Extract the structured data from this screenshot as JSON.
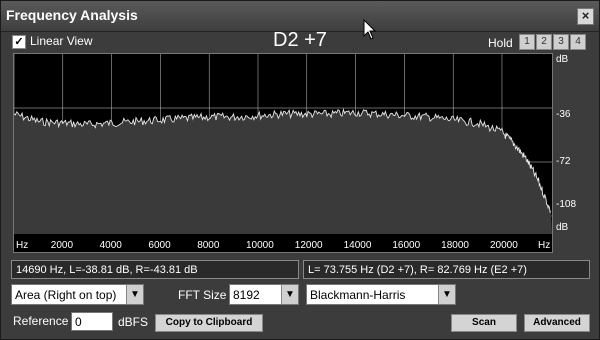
{
  "window": {
    "title": "Frequency Analysis",
    "close_symbol": "×"
  },
  "header": {
    "linear_view_label": "Linear View",
    "linear_view_checked": true,
    "note_label": "D2 +7",
    "hold_label": "Hold",
    "hold_buttons": [
      "1",
      "2",
      "3",
      "4"
    ]
  },
  "plot": {
    "y_axis_labels": [
      "dB",
      "-36",
      "-72",
      "-108",
      "dB"
    ],
    "x_axis_labels": [
      "Hz",
      "2000",
      "4000",
      "6000",
      "8000",
      "10000",
      "12000",
      "14000",
      "16000",
      "18000",
      "20000",
      "Hz"
    ]
  },
  "chart_data": {
    "type": "area",
    "xlabel": "Hz",
    "ylabel": "dB",
    "xlim": [
      0,
      22050
    ],
    "ylim": [
      -120,
      0
    ],
    "x": [
      0,
      1000,
      2000,
      3000,
      4000,
      5000,
      6000,
      7000,
      8000,
      9000,
      10000,
      11000,
      12000,
      13000,
      14000,
      15000,
      16000,
      17000,
      18000,
      19000,
      20000,
      20500,
      21000,
      21500,
      22000
    ],
    "values": [
      -40,
      -45,
      -46,
      -47,
      -46,
      -45,
      -44,
      -43,
      -42,
      -42,
      -41,
      -40,
      -40,
      -40,
      -39,
      -40,
      -41,
      -42,
      -44,
      -46,
      -52,
      -60,
      -70,
      -85,
      -105
    ],
    "grid": true
  },
  "readouts": {
    "cursor": "14690 Hz, L=-38.81 dB, R=-43.81 dB",
    "peak": "L= 73.755 Hz (D2 +7), R= 82.769 Hz (E2 +7)"
  },
  "controls": {
    "mode_select": "Area (Right on top)",
    "fft_size_label": "FFT Size",
    "fft_size_select": "8192",
    "window_select": "Blackmann-Harris",
    "reference_label": "Reference",
    "reference_value": "0",
    "reference_unit": "dBFS",
    "copy_button": "Copy to Clipboard",
    "scan_button": "Scan",
    "advanced_button": "Advanced",
    "arrow_symbol": "▼"
  }
}
